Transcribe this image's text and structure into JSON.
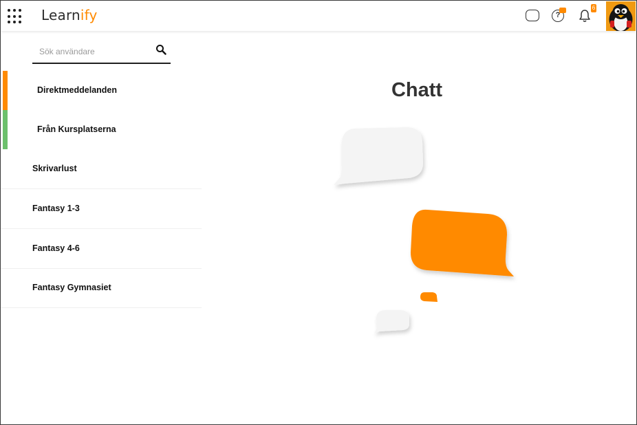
{
  "header": {
    "logo_main": "Learn",
    "logo_accent": "ify",
    "notifications_count": "6"
  },
  "sidebar": {
    "search_placeholder": "Sök användare",
    "categories": [
      {
        "label": "Direktmeddelanden",
        "color": "#ff8a00"
      },
      {
        "label": "Från Kursplatserna",
        "color": "#6cc06c"
      }
    ],
    "courses": [
      {
        "label": "Skrivarlust"
      },
      {
        "label": "Fantasy 1-3"
      },
      {
        "label": "Fantasy 4-6"
      },
      {
        "label": "Fantasy Gymnasiet"
      }
    ]
  },
  "main": {
    "title": "Chatt"
  },
  "colors": {
    "accent": "#ff8a00",
    "green": "#6cc06c",
    "bubble_grey": "#f3f3f3"
  },
  "icons": [
    "apps-grid-icon",
    "chat-icon",
    "help-icon",
    "bell-icon",
    "search-icon"
  ]
}
